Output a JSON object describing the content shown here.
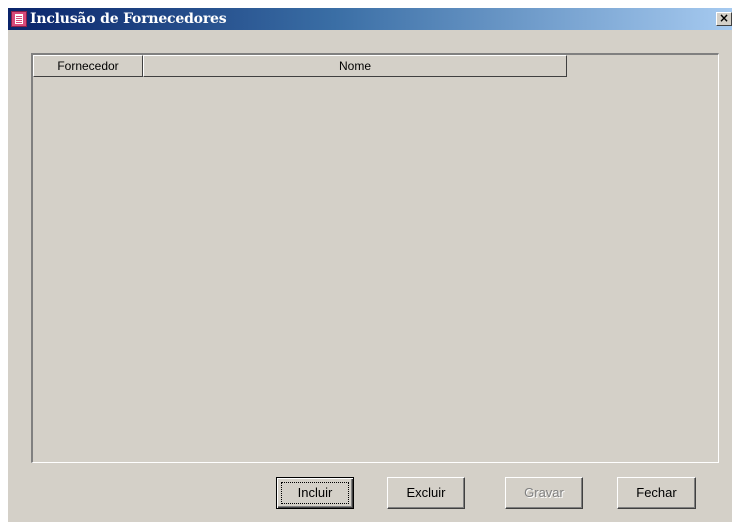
{
  "window": {
    "title": "Inclusão de Fornecedores",
    "close_glyph": "×",
    "icon": "document-icon"
  },
  "grid": {
    "columns": [
      "Fornecedor",
      "Nome"
    ],
    "rows": []
  },
  "buttons": {
    "incluir": "Incluir",
    "excluir": "Excluir",
    "gravar": "Gravar",
    "fechar": "Fechar"
  },
  "colors": {
    "titlebar_start": "#0a246a",
    "titlebar_end": "#a6caf0",
    "face": "#d4d0c8"
  }
}
